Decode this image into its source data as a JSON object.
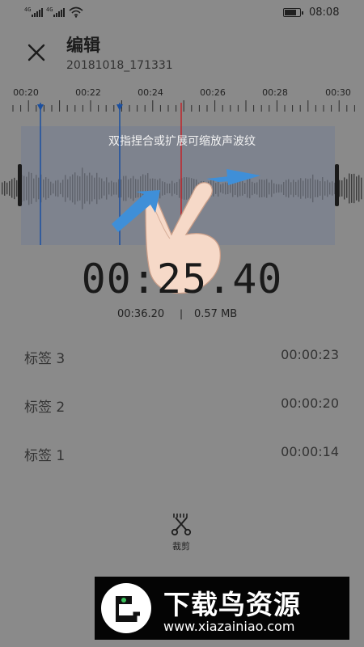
{
  "status_bar": {
    "signal1_label": "4G",
    "signal2_label": "4G",
    "time": "08:08",
    "battery_level": 0.85
  },
  "header": {
    "title": "编辑",
    "subtitle": "20181018_171331",
    "close_icon": "close-icon"
  },
  "timeline": {
    "labels": [
      "00:20",
      "00:22",
      "00:24",
      "00:26",
      "00:28",
      "00:30"
    ]
  },
  "waveform": {
    "instruction": "双指捏合或扩展可缩放声波纹",
    "colors": {
      "marker": "#1a4fa0",
      "playhead": "#c0252a",
      "selection": "#7e838e",
      "arrow": "#3f8fd8"
    }
  },
  "playback": {
    "current_time": "00:25.40",
    "duration": "00:36.20",
    "file_size": "0.57 MB"
  },
  "tags": [
    {
      "label": "标签 3",
      "time": "00:00:23"
    },
    {
      "label": "标签 2",
      "time": "00:00:20"
    },
    {
      "label": "标签 1",
      "time": "00:00:14"
    }
  ],
  "toolbar": {
    "cut_label": "裁剪",
    "cut_icon": "scissors-icon"
  },
  "watermark": {
    "brand": "下载鸟资源",
    "url": "www.xiazainiao.com"
  }
}
